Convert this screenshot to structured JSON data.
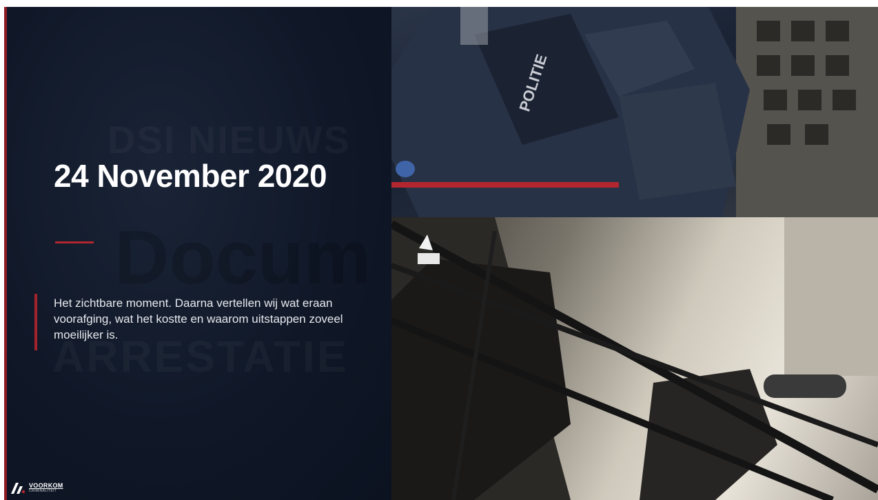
{
  "slide": {
    "date_title": "24 November 2020",
    "description": "Het zichtbare moment. Daarna vertellen wij wat eraan voorafging, wat het kostte en waarom uitstappen zoveel moeilijker is.",
    "watermark": {
      "line1": "DSI NIEUWS",
      "line2": "Docum",
      "line3": "ARRESTATIE"
    },
    "accent_color": "#a3232c"
  },
  "photos": {
    "top": {
      "vest_text": "POLITIE"
    }
  },
  "brand": {
    "logo_main": "VOORKOM",
    "logo_sub": "CRIMINALITEIT"
  }
}
